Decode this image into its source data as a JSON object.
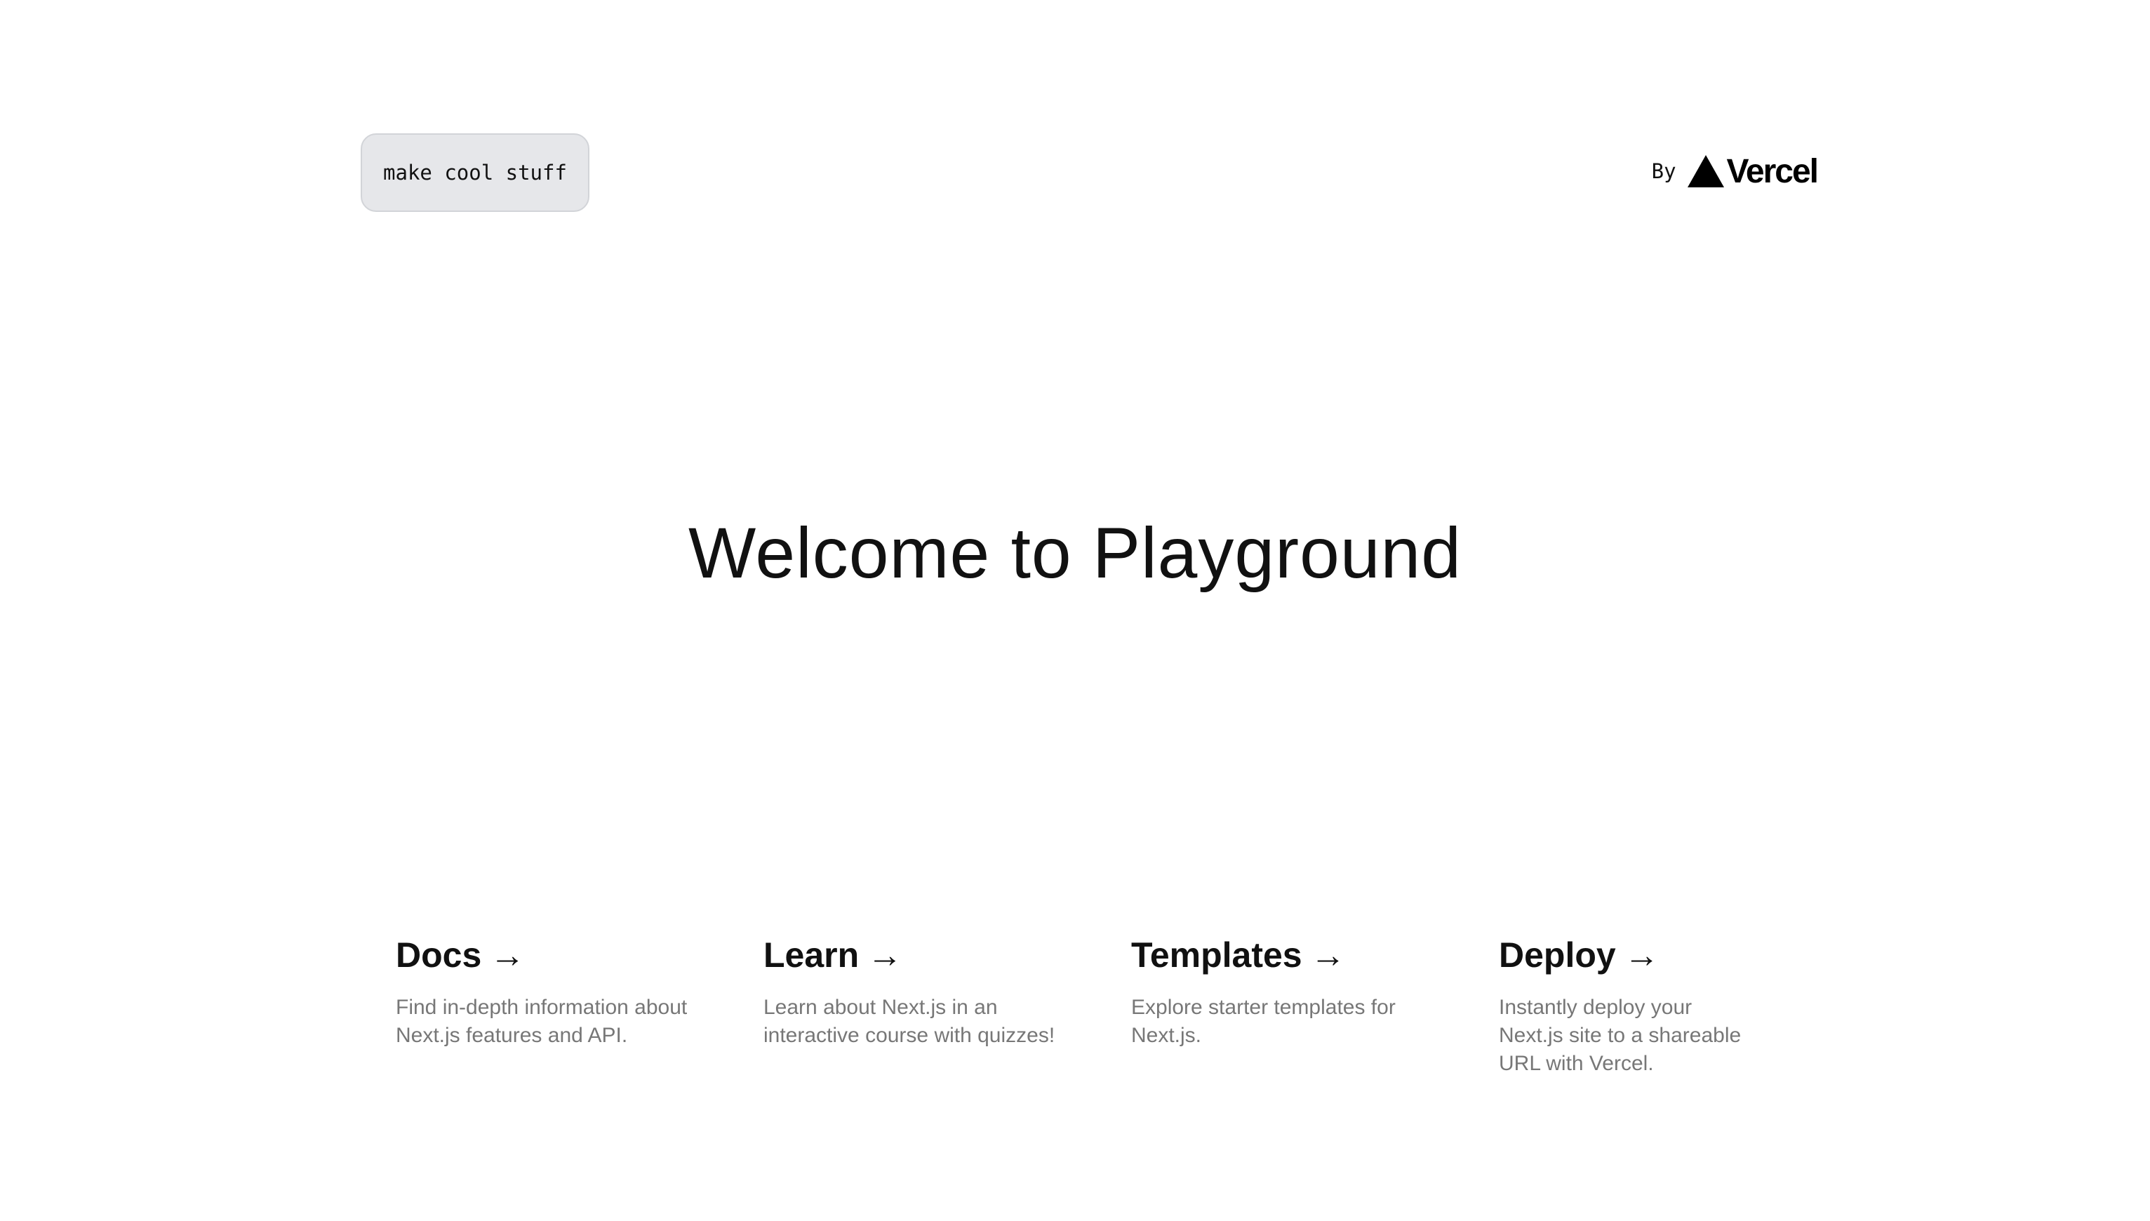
{
  "header": {
    "badge_text": "make cool stuff",
    "by_text": "By",
    "brand_logo_text": "Vercel"
  },
  "hero": {
    "title": "Welcome to Playground"
  },
  "cards": [
    {
      "title": "Docs",
      "arrow": "→",
      "description": "Find in-depth information about Next.js features and API."
    },
    {
      "title": "Learn",
      "arrow": "→",
      "description": "Learn about Next.js in an interactive course with quizzes!"
    },
    {
      "title": "Templates",
      "arrow": "→",
      "description": "Explore starter templates for Next.js."
    },
    {
      "title": "Deploy",
      "arrow": "→",
      "description": "Instantly deploy your Next.js site to a shareable URL with Vercel."
    }
  ],
  "colors": {
    "background": "#ffffff",
    "badge_background": "#e6e7ea",
    "text": "#111111",
    "muted_text": "#777777"
  }
}
